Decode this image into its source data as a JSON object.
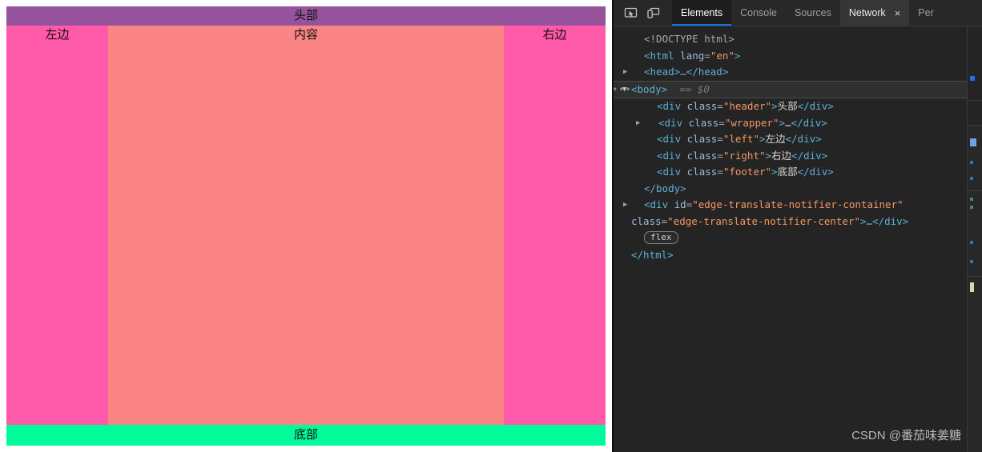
{
  "page": {
    "header_label": "头部",
    "left_label": "左边",
    "content_label": "内容",
    "right_label": "右边",
    "footer_label": "底部",
    "colors": {
      "header": "#96539C",
      "side": "#FF59AA",
      "content": "#FB8585",
      "footer": "#01FB9B"
    }
  },
  "devtools": {
    "toolbar": {
      "inspect_icon": "inspect-element-icon",
      "device_icon": "device-toolbar-icon"
    },
    "tabs": [
      {
        "label": "Elements",
        "active": true,
        "closable": false
      },
      {
        "label": "Console",
        "active": false,
        "closable": false
      },
      {
        "label": "Sources",
        "active": false,
        "closable": false
      },
      {
        "label": "Network",
        "active": false,
        "closable": true,
        "close_label": "×"
      },
      {
        "label": "Per",
        "active": false,
        "closable": false
      }
    ],
    "dom": {
      "doctype": "<!DOCTYPE html>",
      "html_open_tag": "<html",
      "html_attr_name": "lang",
      "html_attr_value": "\"en\"",
      "html_open_close": ">",
      "head_collapsed": "<head>…</head>",
      "body_open": "<body>",
      "body_marker": "== $0",
      "children": [
        {
          "tag": "div",
          "attr": "class",
          "value": "\"header\"",
          "text": "头部",
          "collapsed": false
        },
        {
          "tag": "div",
          "attr": "class",
          "value": "\"wrapper\"",
          "text": "…",
          "collapsed": true
        },
        {
          "tag": "div",
          "attr": "class",
          "value": "\"left\"",
          "text": "左边",
          "collapsed": false
        },
        {
          "tag": "div",
          "attr": "class",
          "value": "\"right\"",
          "text": "右边",
          "collapsed": false
        },
        {
          "tag": "div",
          "attr": "class",
          "value": "\"footer\"",
          "text": "底部",
          "collapsed": false
        }
      ],
      "body_close": "</body>",
      "notifier": {
        "open": "<div",
        "id_attr": "id",
        "id_value": "\"edge-translate-notifier-container\"",
        "class_attr": "class",
        "class_value": "\"edge-translate-notifier-center\"",
        "tail": ">…</div>",
        "badge": "flex"
      },
      "html_close": "</html>"
    }
  },
  "watermark": "CSDN @番茄味姜糖"
}
